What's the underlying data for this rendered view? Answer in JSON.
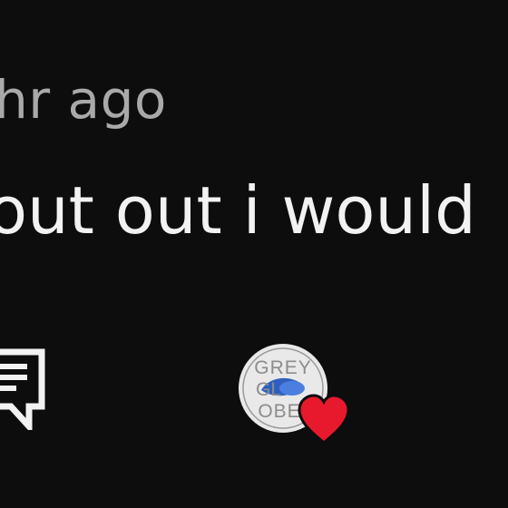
{
  "comment": {
    "timestamp": "hr ago",
    "text": "out out i would"
  },
  "actions": {
    "reply_icon": "comment-reply-icon",
    "creator_avatar_icon": "creator-avatar",
    "heart_icon": "heart-icon",
    "heart_color": "#e8192c"
  },
  "avatar": {
    "logo_lines": [
      "GREY",
      "GL",
      "OBE"
    ]
  }
}
